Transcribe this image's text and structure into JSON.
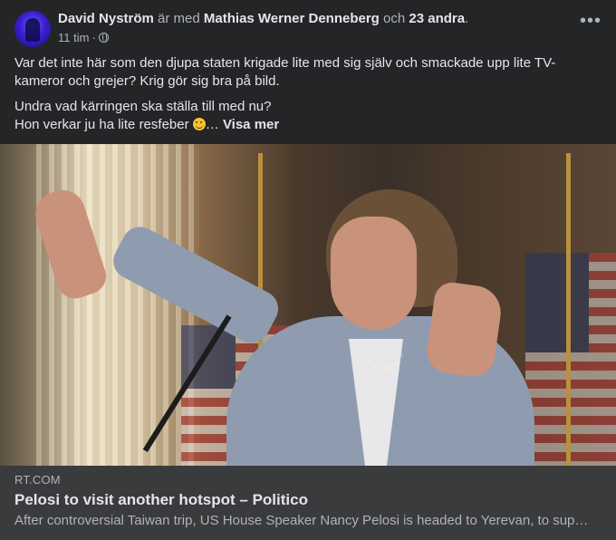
{
  "post": {
    "author": "David Nyström",
    "with_text": "är med",
    "tagged": "Mathias Werner Denneberg",
    "and_text": "och",
    "others": "23 andra",
    "period": ".",
    "time": "11 tim",
    "dot": "·",
    "privacy_icon": "globe-icon",
    "more_icon": "more-options-icon",
    "text": {
      "p1": "Var det inte här som den djupa staten krigade lite med sig själv och smackade upp lite TV-kameror och grejer? Krig gör sig bra på bild.",
      "p2_line1": "Undra vad kärringen ska ställa till med nu?",
      "p2_line2": "Hon verkar ju ha lite resfeber",
      "emoji_icon": "winking-face-emoji-icon",
      "ellipsis": "…",
      "see_more": "Visa mer"
    }
  },
  "link_preview": {
    "domain": "RT.COM",
    "title": "Pelosi to visit another hotspot – Politico",
    "description": "After controversial Taiwan trip, US House Speaker Nancy Pelosi is headed to Yerevan, to sup…"
  }
}
